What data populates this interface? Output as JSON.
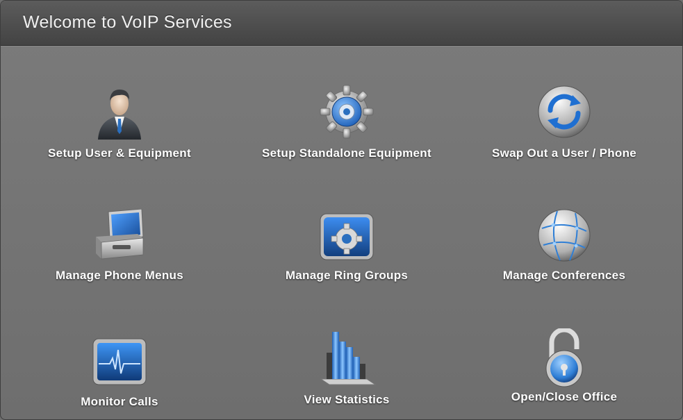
{
  "window": {
    "title": "Welcome to VoIP Services"
  },
  "tiles": [
    {
      "label": "Setup User & Equipment",
      "icon": "user-icon"
    },
    {
      "label": "Setup Standalone Equipment",
      "icon": "gear-icon"
    },
    {
      "label": "Swap Out a User / Phone",
      "icon": "refresh-icon"
    },
    {
      "label": "Manage Phone Menus",
      "icon": "toolbox-icon"
    },
    {
      "label": "Manage Ring Groups",
      "icon": "gear-box-icon"
    },
    {
      "label": "Manage Conferences",
      "icon": "globe-icon"
    },
    {
      "label": "Monitor Calls",
      "icon": "monitor-icon"
    },
    {
      "label": "View Statistics",
      "icon": "bar-chart-icon"
    },
    {
      "label": "Open/Close Office",
      "icon": "padlock-icon"
    }
  ],
  "colors": {
    "background": "#707070",
    "titlebar": "#4a4a4a",
    "accent_blue": "#2f7fd6"
  }
}
